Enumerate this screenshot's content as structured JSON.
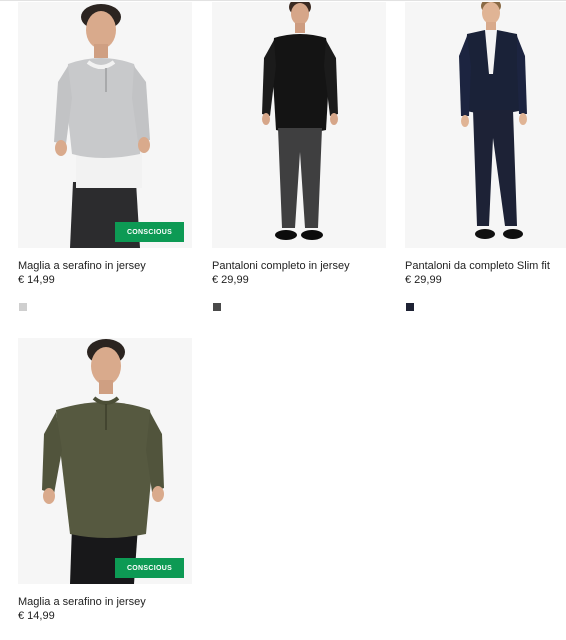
{
  "products": [
    {
      "name": "Maglia a serafino in jersey",
      "price": "€ 14,99",
      "badge": "CONSCIOUS",
      "swatch_color": "#cfcfcf",
      "icon": "model-grey-henley-photo"
    },
    {
      "name": "Pantaloni completo in jersey",
      "price": "€ 29,99",
      "badge": "",
      "swatch_color": "#4a4a4a",
      "icon": "model-black-sweater-photo"
    },
    {
      "name": "Pantaloni da completo Slim fit",
      "price": "€ 29,99",
      "badge": "",
      "swatch_color": "#1e2234",
      "icon": "model-navy-suit-photo"
    },
    {
      "name": "Maglia a serafino in jersey",
      "price": "€ 14,99",
      "badge": "CONSCIOUS",
      "swatch_color": "#cfcfcf",
      "icon": "model-khaki-henley-photo"
    }
  ],
  "colors": {
    "badge": "#0d9a54",
    "photo_background": "#f6f6f6"
  }
}
